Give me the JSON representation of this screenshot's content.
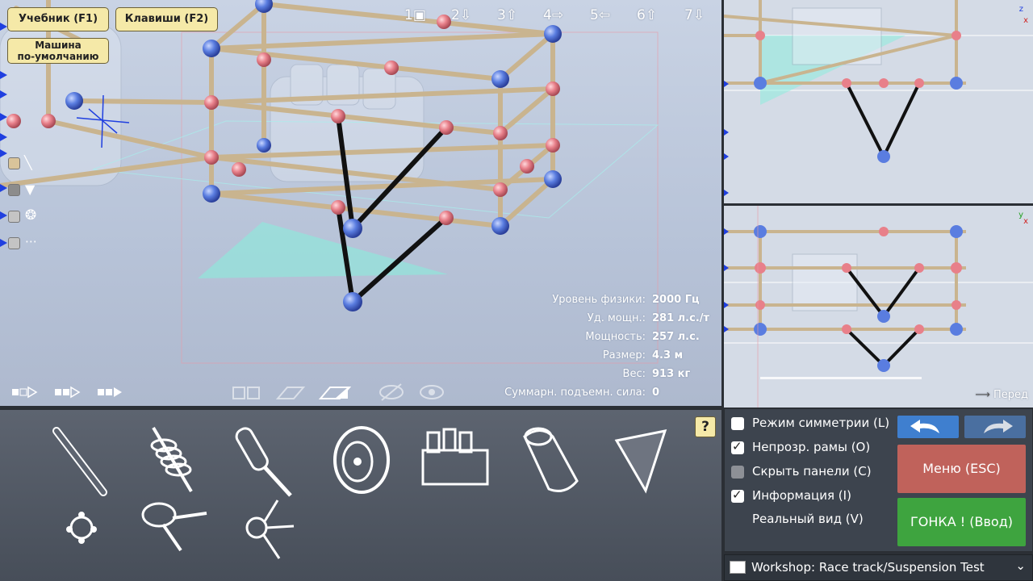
{
  "top_buttons": {
    "tutorial": "Учебник (F1)",
    "keys": "Клавиши (F2)",
    "default_car_line1": "Машина",
    "default_car_line2": "по-умолчанию"
  },
  "view_selector": [
    {
      "num": "1",
      "icon": "camera-icon"
    },
    {
      "num": "2",
      "icon": "arrow-down-icon"
    },
    {
      "num": "3",
      "icon": "arrow-up-icon"
    },
    {
      "num": "4",
      "icon": "arrow-right-icon"
    },
    {
      "num": "5",
      "icon": "arrow-left-icon"
    },
    {
      "num": "6",
      "icon": "arrow-up-icon"
    },
    {
      "num": "7",
      "icon": "arrow-down-icon"
    }
  ],
  "info": {
    "physics_label": "Уровень физики:",
    "physics_value": "2000 Гц",
    "power_ratio_label": "Уд. мощн.:",
    "power_ratio_value": "281 л.с./т",
    "power_label": "Мощность:",
    "power_value": "257 л.с.",
    "size_label": "Размер:",
    "size_value": "4.3 м",
    "weight_label": "Вес:",
    "weight_value": "913 кг",
    "lift_label": "Суммарн. подъемн. сила:",
    "lift_value": "0"
  },
  "side_views": {
    "front_label": "Перед",
    "axis_top": {
      "a": "z",
      "b": "x"
    },
    "axis_bottom": {
      "a": "y",
      "b": "x"
    }
  },
  "palette": {
    "help": "?",
    "parts": [
      "rod-icon",
      "spring-icon",
      "piston-icon",
      "wheel-icon",
      "engine-icon",
      "jet-icon",
      "wing-icon",
      "node-icon",
      "hinge-icon",
      "joint-icon"
    ]
  },
  "options": [
    {
      "label": "Режим симметрии (L)",
      "state": "unchecked"
    },
    {
      "label": "Непрозр. рамы (O)",
      "state": "checked"
    },
    {
      "label": "Скрыть панели (C)",
      "state": "disabled"
    },
    {
      "label": "Информация (I)",
      "state": "checked"
    },
    {
      "label": "Реальный вид (V)",
      "state": "none"
    }
  ],
  "buttons": {
    "menu": "Меню (ESC)",
    "race": "ГОНКА ! (Ввод)"
  },
  "workshop": {
    "text": "Workshop:  Race track/Suspension Test"
  },
  "colors": {
    "menu": "#c0625b",
    "race": "#3ea43f",
    "undo": "#3f7fcf",
    "yellow_button": "#f5e9a8",
    "node_blue": "#5a7de0",
    "node_pink": "#e8808a",
    "rod": "#c9b48f"
  }
}
